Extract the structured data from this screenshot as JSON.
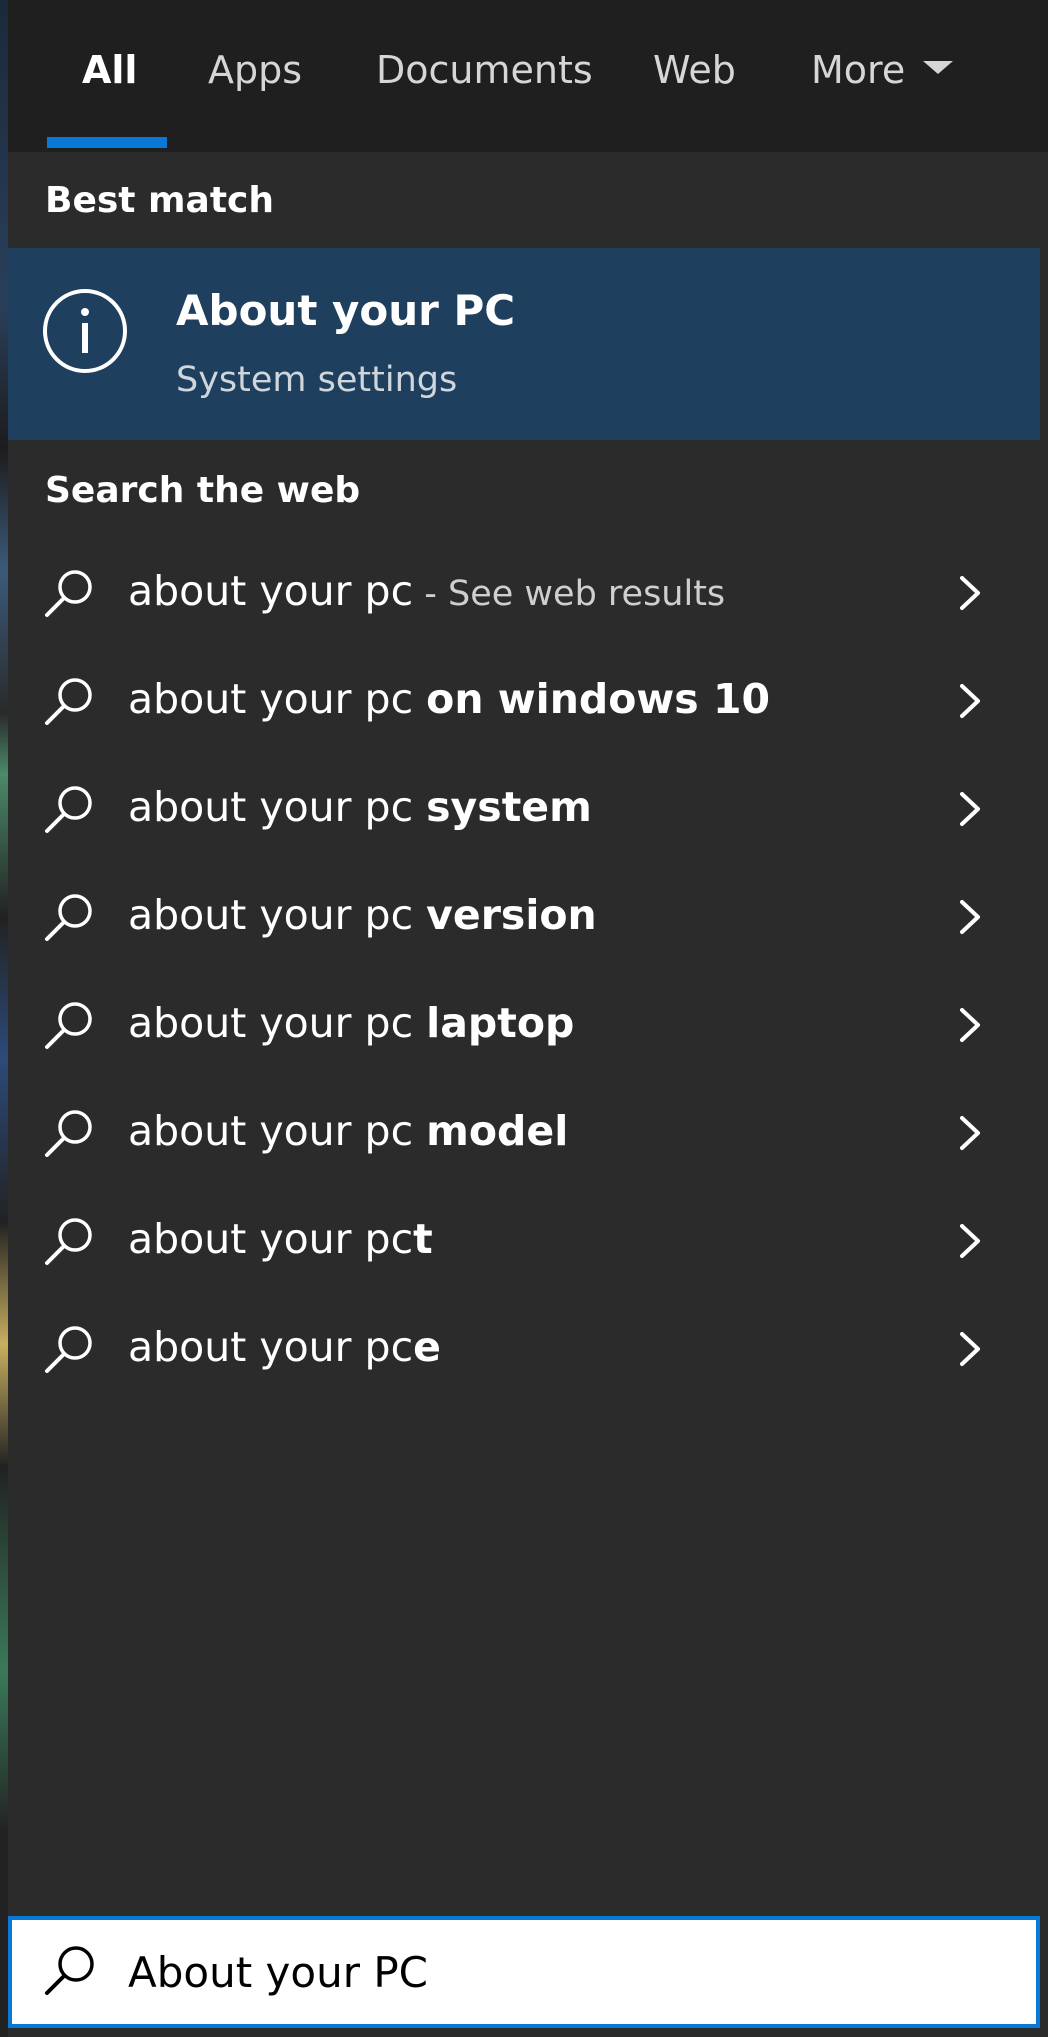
{
  "tabs": [
    {
      "label": "All"
    },
    {
      "label": "Apps"
    },
    {
      "label": "Documents"
    },
    {
      "label": "Web"
    },
    {
      "label": "More"
    }
  ],
  "accent_color": "#0a78d7",
  "best_match": {
    "header": "Best match",
    "title": "About your PC",
    "subtitle": "System settings",
    "icon": "info-icon"
  },
  "web": {
    "header": "Search the web",
    "suggestions": [
      {
        "prefix": "about your pc",
        "bold": "",
        "hint": " - See web results"
      },
      {
        "prefix": "about your pc ",
        "bold": "on windows 10",
        "hint": ""
      },
      {
        "prefix": "about your pc ",
        "bold": "system",
        "hint": ""
      },
      {
        "prefix": "about your pc ",
        "bold": "version",
        "hint": ""
      },
      {
        "prefix": "about your pc ",
        "bold": "laptop",
        "hint": ""
      },
      {
        "prefix": "about your pc ",
        "bold": "model",
        "hint": ""
      },
      {
        "prefix": "about your pc",
        "bold": "t",
        "hint": ""
      },
      {
        "prefix": "about your pc",
        "bold": "e",
        "hint": ""
      }
    ]
  },
  "search": {
    "value": "About your PC"
  }
}
